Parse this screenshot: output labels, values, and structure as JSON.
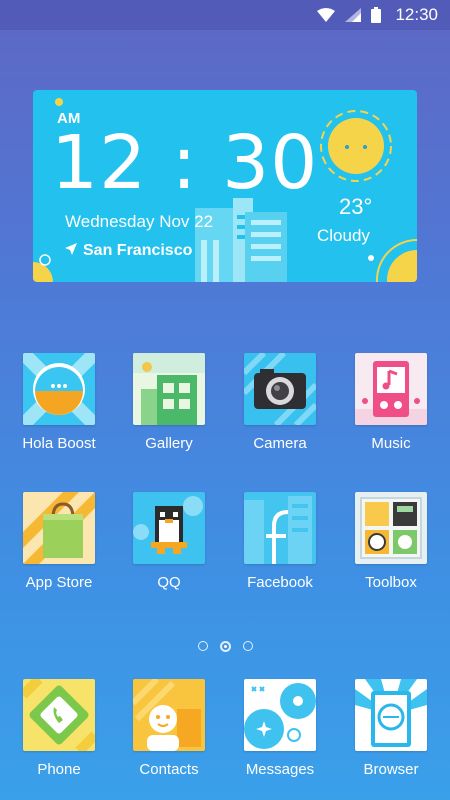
{
  "status_bar": {
    "time": "12:30",
    "icons": [
      "wifi-icon",
      "cell-signal-icon",
      "battery-icon"
    ]
  },
  "widget": {
    "ampm": "AM",
    "time": "12 : 30",
    "date": "Wednesday Nov 22",
    "city": "San Francisco",
    "temperature": "23°",
    "condition": "Cloudy",
    "accent_color": "#22c1ee"
  },
  "apps": {
    "row1": [
      "Hola Boost",
      "Gallery",
      "Camera",
      "Music"
    ],
    "row2": [
      "App Store",
      "QQ",
      "Facebook",
      "Toolbox"
    ],
    "dock": [
      "Phone",
      "Contacts",
      "Messages",
      "Browser"
    ]
  },
  "pager": {
    "pages": 3,
    "current": 2
  }
}
